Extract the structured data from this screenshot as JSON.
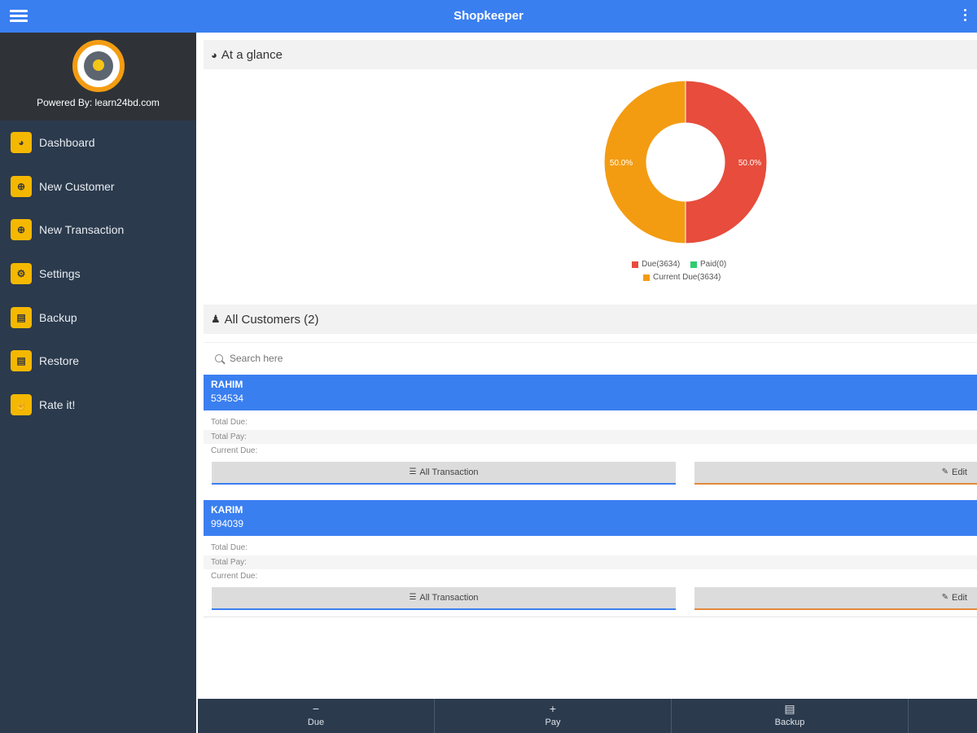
{
  "app": {
    "title": "Shopkeeper"
  },
  "sidebar": {
    "powered_by": "Powered By: learn24bd.com",
    "items": [
      {
        "label": "Dashboard",
        "icon": "dashboard-icon"
      },
      {
        "label": "New Customer",
        "icon": "plus-circle-icon"
      },
      {
        "label": "New Transaction",
        "icon": "plus-circle-icon"
      },
      {
        "label": "Settings",
        "icon": "gear-icon"
      },
      {
        "label": "Backup",
        "icon": "database-icon"
      },
      {
        "label": "Restore",
        "icon": "database-icon"
      },
      {
        "label": "Rate it!",
        "icon": "thumbs-up-icon"
      }
    ]
  },
  "glance": {
    "title": "At a glance",
    "icon": "dashboard-icon"
  },
  "chart_data": {
    "type": "pie",
    "donut": true,
    "slices": [
      {
        "label": "Due(3634)",
        "value": 50.0,
        "color": "#e74c3c"
      },
      {
        "label": "Paid(0)",
        "value": 0.0,
        "color": "#2ecc71"
      },
      {
        "label": "Current Due(3634)",
        "value": 50.0,
        "color": "#f39c12"
      }
    ],
    "data_labels": [
      "50.0%",
      "50.0%"
    ],
    "legend_placement": "bottom"
  },
  "customers_section": {
    "title": "All Customers (2)",
    "icon": "users-icon",
    "search_placeholder": "Search here"
  },
  "customers": [
    {
      "name": "RAHIM",
      "phone": "534534",
      "total_due_label": "Total Due:",
      "total_pay_label": "Total Pay:",
      "current_due_label": "Current Due:",
      "all_transaction_label": "All Transaction",
      "edit_label": "Edit"
    },
    {
      "name": "KARIM",
      "phone": "994039",
      "total_due_label": "Total Due:",
      "total_pay_label": "Total Pay:",
      "current_due_label": "Current Due:",
      "all_transaction_label": "All Transaction",
      "edit_label": "Edit"
    }
  ],
  "bottom_nav": [
    {
      "label": "Due",
      "icon": "minus-icon"
    },
    {
      "label": "Pay",
      "icon": "plus-icon"
    },
    {
      "label": "Backup",
      "icon": "database-icon"
    }
  ],
  "colors": {
    "primary": "#3a7ff0",
    "sidebar": "#2b3a4d",
    "accent": "#f5b800",
    "due": "#e74c3c",
    "paid": "#2ecc71",
    "current_due": "#f39c12"
  }
}
